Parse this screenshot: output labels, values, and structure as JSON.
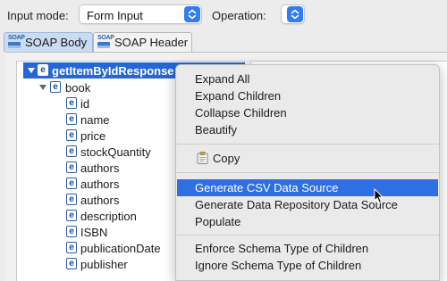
{
  "toolbar": {
    "input_mode_label": "Input mode:",
    "input_mode_value": "Form Input",
    "operation_label": "Operation:",
    "operation_value": ""
  },
  "tabs": [
    {
      "label": "SOAP Body",
      "icon_caption": "SOAP",
      "icon": "soap-icon",
      "active": true
    },
    {
      "label": "SOAP Header",
      "icon_caption": "SOAP",
      "icon": "soap-icon",
      "active": false
    }
  ],
  "tree": {
    "root": {
      "label": "getItemByIdResponse",
      "icon": "element-icon",
      "icon_letter": "e"
    },
    "book": {
      "label": "book",
      "icon_letter": "e"
    },
    "fields": [
      {
        "label": "id",
        "icon_letter": "e"
      },
      {
        "label": "name",
        "icon_letter": "e"
      },
      {
        "label": "price",
        "icon_letter": "e"
      },
      {
        "label": "stockQuantity",
        "icon_letter": "e"
      },
      {
        "label": "authors",
        "icon_letter": "e"
      },
      {
        "label": "authors",
        "icon_letter": "e"
      },
      {
        "label": "authors",
        "icon_letter": "e"
      },
      {
        "label": "description",
        "icon_letter": "e"
      },
      {
        "label": "ISBN",
        "icon_letter": "e"
      },
      {
        "label": "publicationDate",
        "icon_letter": "e"
      },
      {
        "label": "publisher",
        "icon_letter": "e"
      }
    ]
  },
  "context_menu": {
    "groups": [
      [
        "Expand All",
        "Expand Children",
        "Collapse Children",
        "Beautify"
      ],
      [
        "Copy"
      ],
      [
        "Generate CSV Data Source",
        "Generate Data Repository Data Source",
        "Populate"
      ],
      [
        "Enforce Schema Type of Children",
        "Ignore Schema Type of Children"
      ]
    ],
    "highlighted": "Generate CSV Data Source",
    "copy_icon": "clipboard-icon"
  },
  "colors": {
    "selection": "#2667d6",
    "menu_highlight": "#2f6fe3",
    "tab_active": "#c9dcf3",
    "stepper": "#2f7cf6"
  }
}
